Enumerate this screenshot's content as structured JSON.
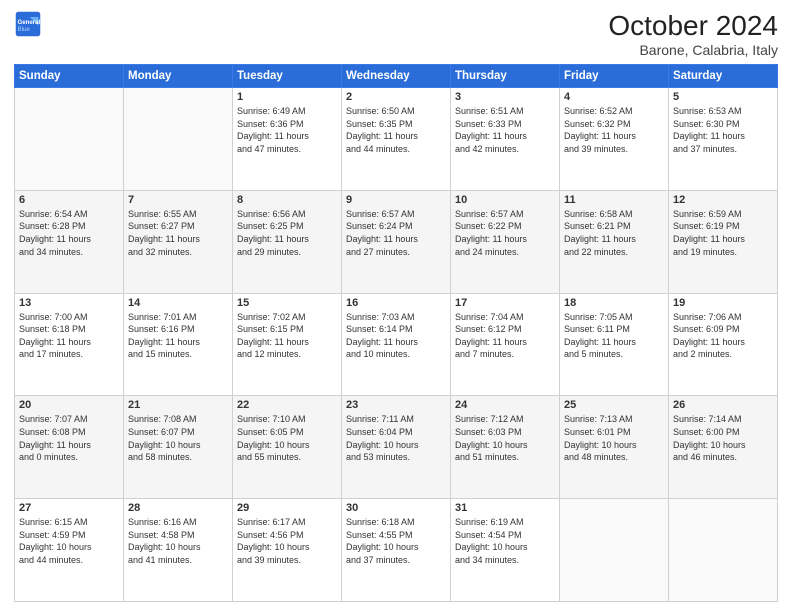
{
  "header": {
    "logo_line1": "General",
    "logo_line2": "Blue",
    "title": "October 2024",
    "subtitle": "Barone, Calabria, Italy"
  },
  "weekdays": [
    "Sunday",
    "Monday",
    "Tuesday",
    "Wednesday",
    "Thursday",
    "Friday",
    "Saturday"
  ],
  "weeks": [
    [
      {
        "day": "",
        "info": ""
      },
      {
        "day": "",
        "info": ""
      },
      {
        "day": "1",
        "info": "Sunrise: 6:49 AM\nSunset: 6:36 PM\nDaylight: 11 hours\nand 47 minutes."
      },
      {
        "day": "2",
        "info": "Sunrise: 6:50 AM\nSunset: 6:35 PM\nDaylight: 11 hours\nand 44 minutes."
      },
      {
        "day": "3",
        "info": "Sunrise: 6:51 AM\nSunset: 6:33 PM\nDaylight: 11 hours\nand 42 minutes."
      },
      {
        "day": "4",
        "info": "Sunrise: 6:52 AM\nSunset: 6:32 PM\nDaylight: 11 hours\nand 39 minutes."
      },
      {
        "day": "5",
        "info": "Sunrise: 6:53 AM\nSunset: 6:30 PM\nDaylight: 11 hours\nand 37 minutes."
      }
    ],
    [
      {
        "day": "6",
        "info": "Sunrise: 6:54 AM\nSunset: 6:28 PM\nDaylight: 11 hours\nand 34 minutes."
      },
      {
        "day": "7",
        "info": "Sunrise: 6:55 AM\nSunset: 6:27 PM\nDaylight: 11 hours\nand 32 minutes."
      },
      {
        "day": "8",
        "info": "Sunrise: 6:56 AM\nSunset: 6:25 PM\nDaylight: 11 hours\nand 29 minutes."
      },
      {
        "day": "9",
        "info": "Sunrise: 6:57 AM\nSunset: 6:24 PM\nDaylight: 11 hours\nand 27 minutes."
      },
      {
        "day": "10",
        "info": "Sunrise: 6:57 AM\nSunset: 6:22 PM\nDaylight: 11 hours\nand 24 minutes."
      },
      {
        "day": "11",
        "info": "Sunrise: 6:58 AM\nSunset: 6:21 PM\nDaylight: 11 hours\nand 22 minutes."
      },
      {
        "day": "12",
        "info": "Sunrise: 6:59 AM\nSunset: 6:19 PM\nDaylight: 11 hours\nand 19 minutes."
      }
    ],
    [
      {
        "day": "13",
        "info": "Sunrise: 7:00 AM\nSunset: 6:18 PM\nDaylight: 11 hours\nand 17 minutes."
      },
      {
        "day": "14",
        "info": "Sunrise: 7:01 AM\nSunset: 6:16 PM\nDaylight: 11 hours\nand 15 minutes."
      },
      {
        "day": "15",
        "info": "Sunrise: 7:02 AM\nSunset: 6:15 PM\nDaylight: 11 hours\nand 12 minutes."
      },
      {
        "day": "16",
        "info": "Sunrise: 7:03 AM\nSunset: 6:14 PM\nDaylight: 11 hours\nand 10 minutes."
      },
      {
        "day": "17",
        "info": "Sunrise: 7:04 AM\nSunset: 6:12 PM\nDaylight: 11 hours\nand 7 minutes."
      },
      {
        "day": "18",
        "info": "Sunrise: 7:05 AM\nSunset: 6:11 PM\nDaylight: 11 hours\nand 5 minutes."
      },
      {
        "day": "19",
        "info": "Sunrise: 7:06 AM\nSunset: 6:09 PM\nDaylight: 11 hours\nand 2 minutes."
      }
    ],
    [
      {
        "day": "20",
        "info": "Sunrise: 7:07 AM\nSunset: 6:08 PM\nDaylight: 11 hours\nand 0 minutes."
      },
      {
        "day": "21",
        "info": "Sunrise: 7:08 AM\nSunset: 6:07 PM\nDaylight: 10 hours\nand 58 minutes."
      },
      {
        "day": "22",
        "info": "Sunrise: 7:10 AM\nSunset: 6:05 PM\nDaylight: 10 hours\nand 55 minutes."
      },
      {
        "day": "23",
        "info": "Sunrise: 7:11 AM\nSunset: 6:04 PM\nDaylight: 10 hours\nand 53 minutes."
      },
      {
        "day": "24",
        "info": "Sunrise: 7:12 AM\nSunset: 6:03 PM\nDaylight: 10 hours\nand 51 minutes."
      },
      {
        "day": "25",
        "info": "Sunrise: 7:13 AM\nSunset: 6:01 PM\nDaylight: 10 hours\nand 48 minutes."
      },
      {
        "day": "26",
        "info": "Sunrise: 7:14 AM\nSunset: 6:00 PM\nDaylight: 10 hours\nand 46 minutes."
      }
    ],
    [
      {
        "day": "27",
        "info": "Sunrise: 6:15 AM\nSunset: 4:59 PM\nDaylight: 10 hours\nand 44 minutes."
      },
      {
        "day": "28",
        "info": "Sunrise: 6:16 AM\nSunset: 4:58 PM\nDaylight: 10 hours\nand 41 minutes."
      },
      {
        "day": "29",
        "info": "Sunrise: 6:17 AM\nSunset: 4:56 PM\nDaylight: 10 hours\nand 39 minutes."
      },
      {
        "day": "30",
        "info": "Sunrise: 6:18 AM\nSunset: 4:55 PM\nDaylight: 10 hours\nand 37 minutes."
      },
      {
        "day": "31",
        "info": "Sunrise: 6:19 AM\nSunset: 4:54 PM\nDaylight: 10 hours\nand 34 minutes."
      },
      {
        "day": "",
        "info": ""
      },
      {
        "day": "",
        "info": ""
      }
    ]
  ]
}
